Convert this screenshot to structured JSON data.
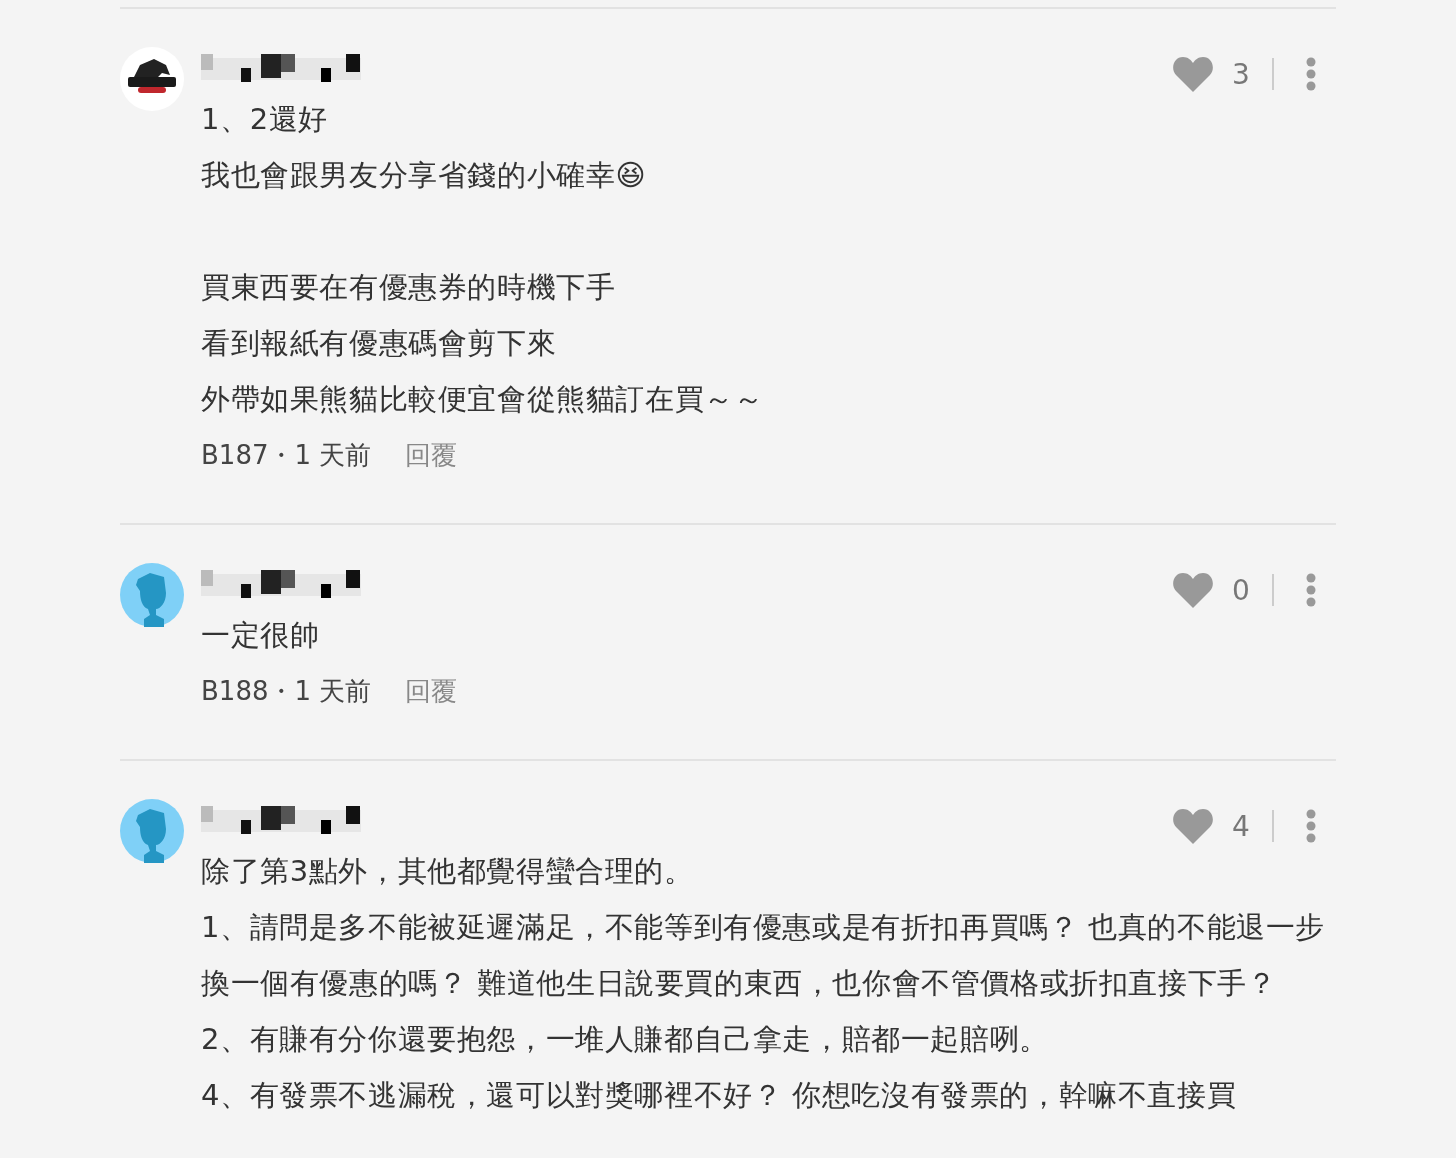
{
  "comments": [
    {
      "avatar": {
        "kind": "logo"
      },
      "likes": "3",
      "paragraphs": [
        [
          "1、2還好",
          "我也會跟男友分享省錢的小確幸😆"
        ],
        [
          "買東西要在有優惠券的時機下手",
          "看到報紙有優惠碼會剪下來",
          "外帶如果熊貓比較便宜會從熊貓訂在買～～"
        ]
      ],
      "meta": "B187・1 天前",
      "reply": "回覆"
    },
    {
      "avatar": {
        "kind": "default"
      },
      "likes": "0",
      "paragraphs": [
        [
          "一定很帥"
        ]
      ],
      "meta": "B188・1 天前",
      "reply": "回覆"
    },
    {
      "avatar": {
        "kind": "default"
      },
      "likes": "4",
      "paragraphs": [
        [
          "除了第3點外，其他都覺得蠻合理的。",
          "1、請問是多不能被延遲滿足，不能等到有優惠或是有折扣再買嗎？ 也真的不能退一步換一個有優惠的嗎？ 難道他生日說要買的東西，也你會不管價格或折扣直接下手？",
          "2、有賺有分你還要抱怨，一堆人賺都自己拿走，賠都一起賠咧。",
          "4、有發票不逃漏稅，還可以對獎哪裡不好？ 你想吃沒有發票的，幹嘛不直接買"
        ]
      ]
    }
  ]
}
